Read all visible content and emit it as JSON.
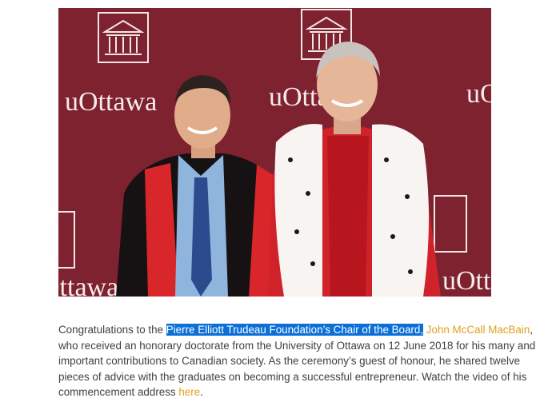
{
  "photo": {
    "backdrop_text": "uOttawa",
    "backdrop_color": "#7e2230",
    "people": [
      "man-in-black-and-red-gown",
      "man-in-red-and-ermine-robe"
    ]
  },
  "caption": {
    "prefix": "Congratulations to the ",
    "selected_text": "Pierre Elliott Trudeau Foundation’s Chair of the Board,",
    "name_link": "John McCall MacBain",
    "body": ", who received an honorary doctorate from the University of Ottawa on 12 June 2018 for his many and important contributions to Canadian society. As the ceremony’s guest of honour, he shared twelve pieces of advice with the graduates on becoming a successful entrepreneur. Watch the video of his commencement address ",
    "here_link": "here",
    "suffix": ".",
    "selection_color": "#0a6fd6",
    "link_color": "#e0a020"
  }
}
